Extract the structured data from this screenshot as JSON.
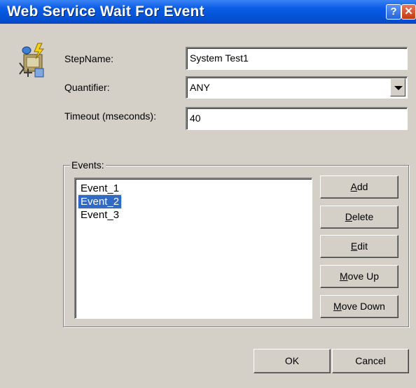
{
  "window": {
    "title": "Web Service Wait For Event",
    "help_glyph": "?",
    "close_glyph": "✕"
  },
  "form": {
    "stepname_label": "StepName:",
    "stepname_value": "System Test1",
    "quantifier_label": "Quantifier:",
    "quantifier_value": "ANY",
    "timeout_label": "Timeout (mseconds):",
    "timeout_value": "40"
  },
  "events": {
    "group_label": "Events:",
    "items": [
      "Event_1",
      "Event_2",
      "Event_3"
    ],
    "selected": "Event_2"
  },
  "buttons": {
    "add": {
      "mnemonic": "A",
      "rest": "dd"
    },
    "delete": {
      "mnemonic": "D",
      "rest": "elete"
    },
    "edit": {
      "mnemonic": "E",
      "rest": "dit"
    },
    "move_up": {
      "mnemonic": "M",
      "rest": "ove Up"
    },
    "move_down": {
      "mnemonic": "M",
      "rest": "ove Down"
    },
    "ok": "OK",
    "cancel": "Cancel"
  },
  "icons": {
    "step_icon": "event-wait-icon",
    "dropdown": "chevron-down-icon"
  }
}
